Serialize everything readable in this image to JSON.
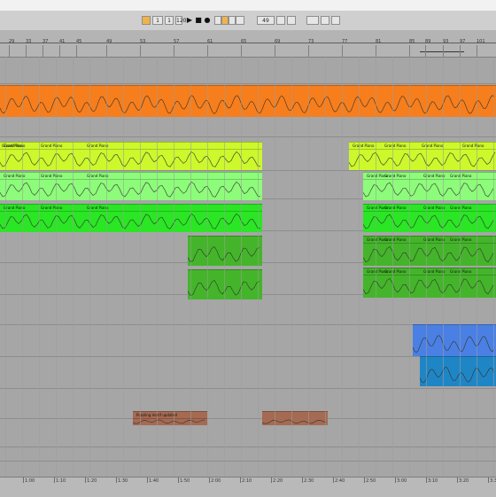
{
  "transport": {
    "tempo": "120",
    "signature": "4 / 4",
    "position": "49",
    "loop_start": "1",
    "loop_length": "1",
    "play_icon": "play-icon",
    "stop_icon": "stop-icon",
    "record_icon": "record-icon"
  },
  "ruler": {
    "bars": [
      "29",
      "33",
      "37",
      "41",
      "45",
      "49",
      "53",
      "57",
      "61",
      "65",
      "69",
      "73",
      "77",
      "81",
      "85",
      "89",
      "93",
      "97",
      "101"
    ],
    "markers": [
      "1 1:00",
      "1 1:00",
      "2 1:00",
      "3 1:00",
      "4 1:00",
      "1 1:00",
      "5 1:00",
      "7 1:00",
      "8 1:00",
      "1 1:00",
      "9 1:00",
      "1 1:00"
    ]
  },
  "timeline": {
    "times": [
      "1:00",
      "1:10",
      "1:20",
      "1:30",
      "1:40",
      "1:50",
      "2:00",
      "2:10",
      "2:20",
      "2:30",
      "2:40",
      "2:50",
      "3:00",
      "3:10",
      "3:20",
      "3:30"
    ]
  },
  "clips": {
    "grand_piano": "Grand Piano",
    "puzzling_motif": "Puzzling motif updated"
  },
  "colors": {
    "orange": "#f67e1c",
    "yellow_green": "#ccf82c",
    "light_green": "#8dfc7a",
    "green": "#2ae624",
    "dark_green": "#44b52a",
    "blue": "#4a80e4",
    "dark_blue": "#1f86c6",
    "brown": "#a56a52"
  }
}
